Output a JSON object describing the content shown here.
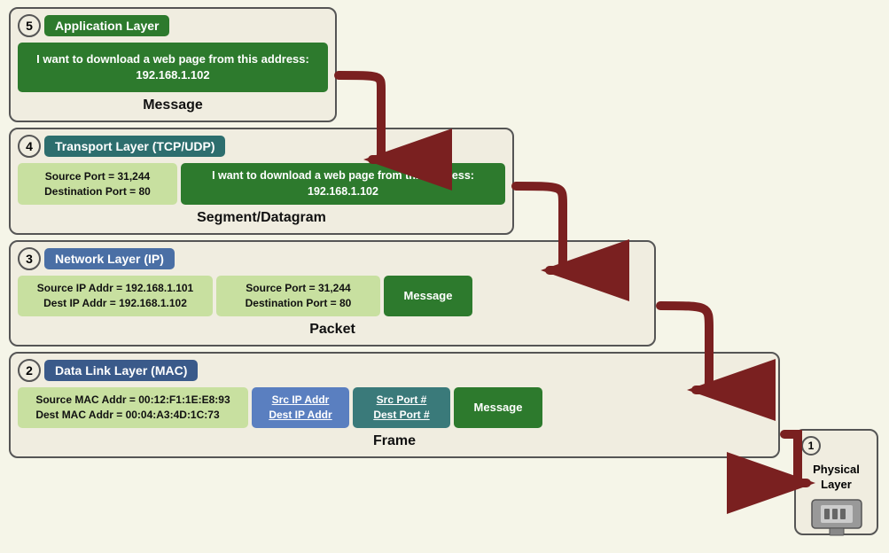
{
  "layers": {
    "application": {
      "number": "5",
      "title": "Application Layer",
      "title_class": "green",
      "message": "I want to download a web page from this address: 192.168.1.102",
      "label": "Message",
      "cell_class": "cell-green"
    },
    "transport": {
      "number": "4",
      "title": "Transport Layer (TCP/UDP)",
      "title_class": "blue-green",
      "header_text": "Source Port = 31,244\nDestination Port = 80",
      "message": "I want to download a web page from this address: 192.168.1.102",
      "label": "Segment/Datagram",
      "header_class": "cell-light-green",
      "message_class": "cell-green"
    },
    "network": {
      "number": "3",
      "title": "Network Layer (IP)",
      "title_class": "steel-blue",
      "ip_header": "Source IP Addr = 192.168.1.101\nDest IP Addr = 192.168.1.102",
      "port_header": "Source Port = 31,244\nDestination Port = 80",
      "message": "Message",
      "label": "Packet",
      "ip_class": "cell-light-green",
      "port_class": "cell-light-green",
      "msg_class": "cell-green"
    },
    "datalink": {
      "number": "2",
      "title": "Data Link Layer (MAC)",
      "title_class": "dark-blue",
      "mac_header": "Source MAC Addr = 00:12:F1:1E:E8:93\nDest MAC Addr = 00:04:A3:4D:1C:73",
      "ip_cell_line1": "Src IP Addr",
      "ip_cell_line2": "Dest IP Addr",
      "port_cell_line1": "Src Port #",
      "port_cell_line2": "Dest Port #",
      "message": "Message",
      "label": "Frame",
      "mac_class": "cell-light-green",
      "ip_class": "cell-steel-blue",
      "port_class": "cell-teal",
      "msg_class": "cell-green"
    },
    "physical": {
      "number": "1",
      "label": "Physical\nLayer"
    }
  },
  "colors": {
    "dark_arrow": "#7a2020",
    "border": "#555"
  }
}
